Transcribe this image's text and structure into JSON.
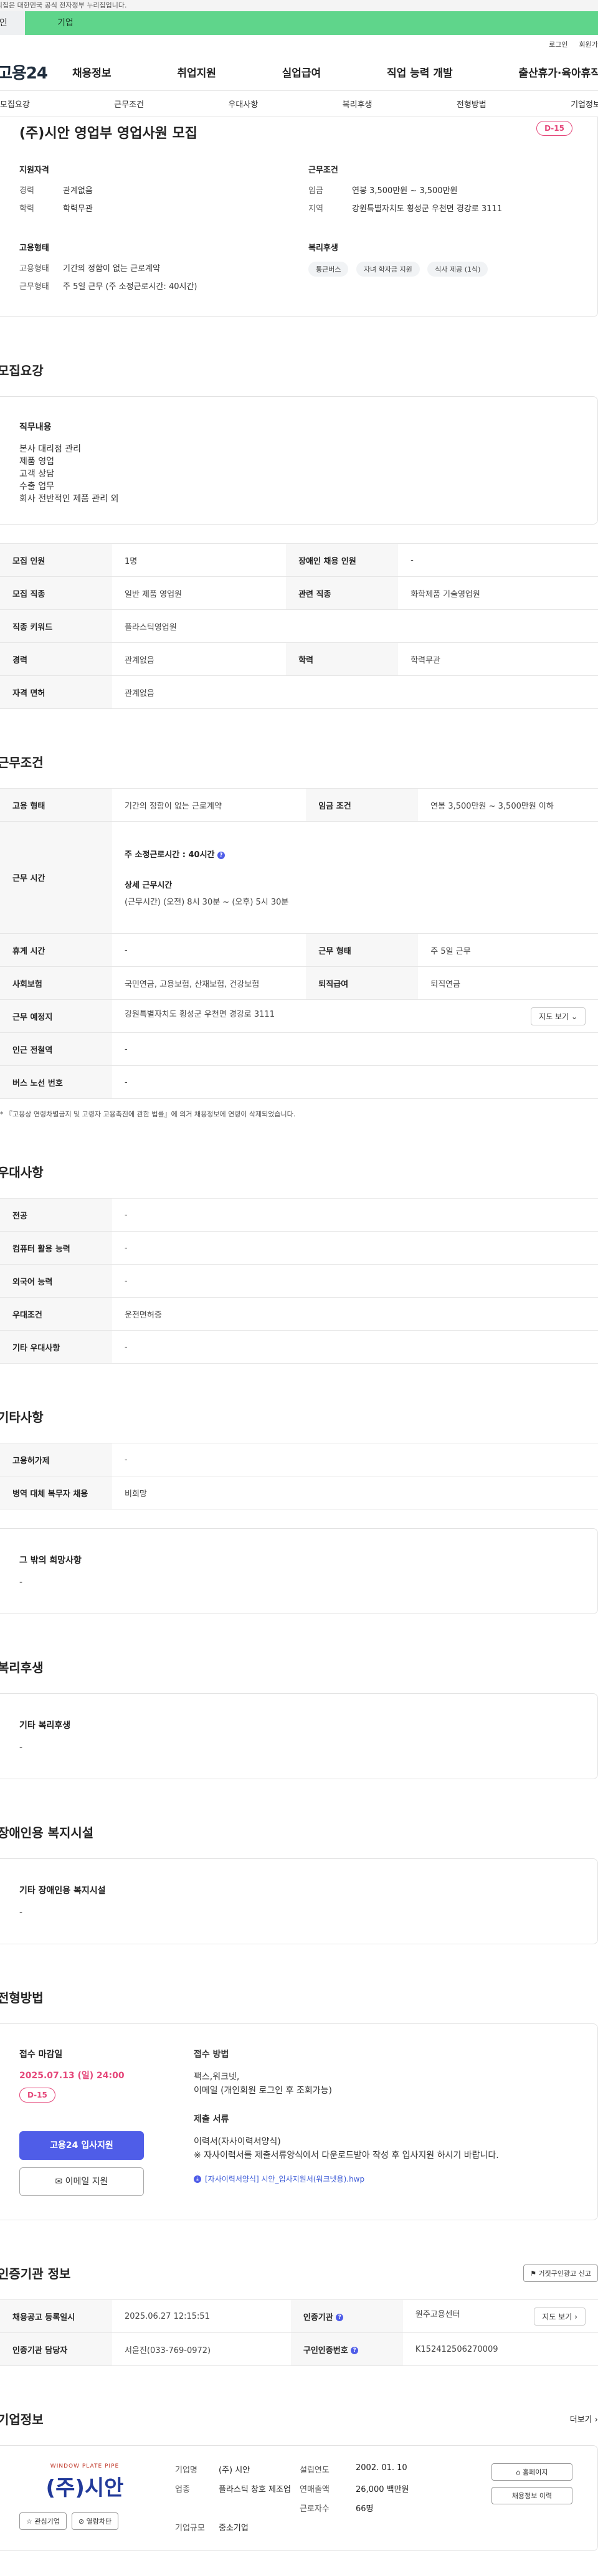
{
  "gov_strip": "이 누리집은 대한민국 공식 전자정부 누리집입니다.",
  "tabs": {
    "person": "개인",
    "corp": "기업"
  },
  "util": {
    "login": "로그인",
    "signup": "회원가입"
  },
  "logo": "고용24",
  "gnb": [
    "채용정보",
    "취업지원",
    "실업급여",
    "직업 능력 개발",
    "출산휴가·육아휴직"
  ],
  "subnav": [
    "모집요강",
    "근무조건",
    "우대사항",
    "복리후생",
    "전형방법",
    "기업정보"
  ],
  "hero": {
    "title": "(주)시안 영업부 영업사원 모집",
    "dday": "D-15",
    "qual_title": "지원자격",
    "qual_career_k": "경력",
    "qual_career_v": "관계없음",
    "qual_edu_k": "학력",
    "qual_edu_v": "학력무관",
    "cond_title": "근무조건",
    "cond_wage_k": "임금",
    "cond_wage_v": "연봉 3,500만원 ~ 3,500만원",
    "cond_area_k": "지역",
    "cond_area_v": "강원특별자치도 횡성군 우천면 경강로 3111",
    "emp_title": "고용형태",
    "emp_type_k": "고용형태",
    "emp_type_v": "기간의 정함이 없는 근로계약",
    "emp_work_k": "근무형태",
    "emp_work_v": "주 5일 근무 (주 소정근로시간: 40시간)",
    "welfare_title": "복리후생",
    "chips": [
      "통근버스",
      "자녀 학자금 지원",
      "식사 제공 (1식)"
    ]
  },
  "recruit": {
    "title": "모집요강",
    "duty_title": "직무내용",
    "duty_lines": [
      "본사 대리점 관리",
      "제품 영업",
      "고객 상담",
      "수출 업무",
      "회사 전반적인 제품 관리 외"
    ],
    "rows": {
      "count_k": "모집 인원",
      "count_v": "1명",
      "disabled_k": "장애인 채용 인원",
      "disabled_v": "-",
      "job_k": "모집 직종",
      "job_v": "일반 제품 영업원",
      "related_k": "관련 직종",
      "related_v": "화학제품 기술영업원",
      "keyword_k": "직종 키워드",
      "keyword_v": "플라스틱영업원",
      "career_k": "경력",
      "career_v": "관계없음",
      "edu_k": "학력",
      "edu_v": "학력무관",
      "license_k": "자격 면허",
      "license_v": "관계없음"
    }
  },
  "work": {
    "title": "근무조건",
    "emp_k": "고용 형태",
    "emp_v": "기간의 정함이 없는 근로계약",
    "wage_k": "임금 조건",
    "wage_v": "연봉 3,500만원 ~ 3,500만원 이하",
    "hours_k": "근무 시간",
    "hours_main": "주 소정근로시간 : 40시간",
    "hours_detail_label": "상세 근무시간",
    "hours_detail_v": "(근무시간) (오전) 8시 30분 ~ (오후) 5시 30분",
    "rest_k": "휴게 시간",
    "rest_v": "-",
    "shape_k": "근무 형태",
    "shape_v": "주 5일 근무",
    "ins_k": "사회보험",
    "ins_v": "국민연금, 고용보험, 산재보험, 건강보험",
    "retire_k": "퇴직급여",
    "retire_v": "퇴직연금",
    "place_k": "근무 예정지",
    "place_v": "강원특별자치도 횡성군 우천면 경강로 3111",
    "map_btn": "지도 보기",
    "station_k": "인근 전철역",
    "station_v": "-",
    "bus_k": "버스 노선 번호",
    "bus_v": "-",
    "note": "* 『고용상 연령차별금지 및 고령자 고용촉진에 관한 법률』에 의거 채용정보에 연령이 삭제되었습니다."
  },
  "pref": {
    "title": "우대사항",
    "major_k": "전공",
    "major_v": "-",
    "pc_k": "컴퓨터 활용 능력",
    "pc_v": "-",
    "lang_k": "외국어 능력",
    "lang_v": "-",
    "cond_k": "우대조건",
    "cond_v": "운전면허증",
    "etc_k": "기타 우대사항",
    "etc_v": "-"
  },
  "etc": {
    "title": "기타사항",
    "ins_k": "고용허가제",
    "ins_v": "-",
    "mil_k": "병역 대체 복무자 채용",
    "mil_v": "비희망",
    "wish_title": "그 밖의 희망사항",
    "wish_v": "-"
  },
  "welfare": {
    "title": "복리후생",
    "box_title": "기타 복리후생",
    "box_v": "-"
  },
  "disabled": {
    "title": "장애인용 복지시설",
    "box_title": "기타 장애인용 복지시설",
    "box_v": "-"
  },
  "selection": {
    "title": "전형방법",
    "deadline_label": "접수 마감일",
    "deadline_v": "2025.07.13 (일) 24:00",
    "dday": "D-15",
    "apply_btn": "고용24 입사지원",
    "email_btn": "이메일 지원",
    "method_label": "접수 방법",
    "method_v1": "팩스,워크넷,",
    "method_v2": "이메일 (개인회원 로그인 후 조회가능)",
    "docs_label": "제출 서류",
    "docs_v1": "이력서(자사이력서양식)",
    "docs_v2": "※ 자사이력서를 제출서류양식에서 다운로드받아 작성 후 입사지원 하시기 바랍니다.",
    "attach": "[자사이력서양식] 시안_입사지원서(워크넷용).hwp"
  },
  "cert": {
    "title": "인증기관 정보",
    "report_btn": "거짓구인광고 신고",
    "reg_k": "채용공고 등록일시",
    "reg_v": "2025.06.27 12:15:51",
    "org_k": "인증기관",
    "org_v": "원주고용센터",
    "map_btn": "지도 보기",
    "manager_k": "인증기관 담당자",
    "manager_v": "서윤진(033-769-0972)",
    "num_k": "구인인증번호",
    "num_v": "K152412506270009"
  },
  "company": {
    "title": "기업정보",
    "more": "더보기",
    "logo_sub": "WINDOW PLATE PIPE",
    "logo_text": "(주)시안",
    "fav_btn": "관심기업",
    "block_btn": "열람차단",
    "name_k": "기업명",
    "name_v": "(주) 시안",
    "found_k": "설립연도",
    "found_v": "2002. 01. 10",
    "biz_k": "업종",
    "biz_v": "플라스틱 창호 제조업",
    "sales_k": "연매출액",
    "sales_v": "26,000 백만원",
    "emp_k": "근로자수",
    "emp_v": "66명",
    "scale_k": "기업규모",
    "scale_v": "중소기업",
    "home_btn": "홈페이지",
    "history_btn": "채용정보 이력"
  }
}
